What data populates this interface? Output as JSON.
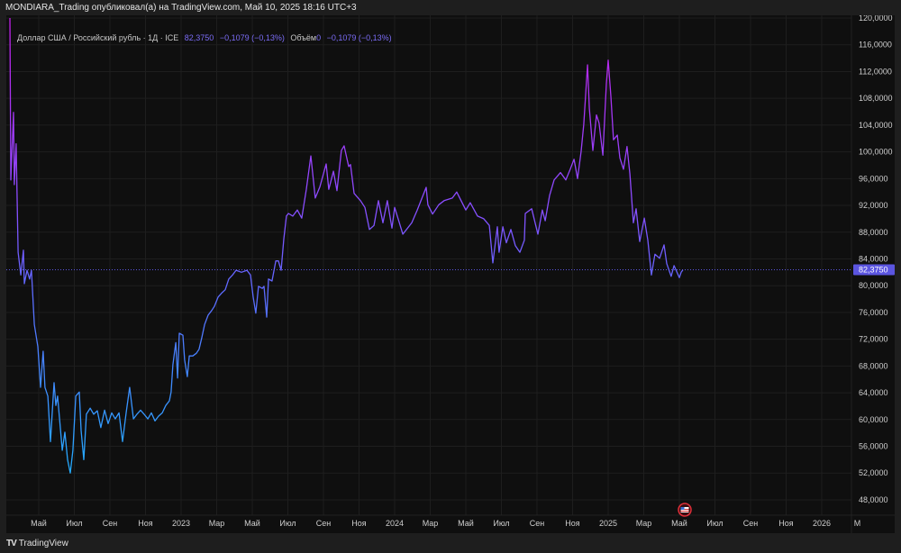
{
  "header": {
    "title": "MONDIARA_Trading опубликовал(а) на TradingView.com, Май 10, 2025 18:16 UTC+3"
  },
  "legend": {
    "symbol": "Доллар США / Российский рубль · 1Д · ICE",
    "price": "82,3750",
    "change": "−0,1079 (−0,13%)",
    "volume_label": "Объём",
    "volume_value": "0",
    "volume_change": "−0,1079 (−0,13%)"
  },
  "footer": {
    "brand": "TradingView"
  },
  "colors": {
    "background": "#0f0f0f",
    "line_top": "#c21fe8",
    "line_mid": "#8a4cff",
    "line_low": "#5b6cff",
    "line_bottom": "#1fb0ff",
    "last_price": "#5b55e0"
  },
  "chart_data": {
    "type": "line",
    "title": "Доллар США / Российский рубль · 1Д · ICE",
    "x_unit": "months since 2022-01",
    "ylim": [
      46,
      121
    ],
    "xlim": [
      1.7,
      50.2
    ],
    "y_ticks": [
      "48,0000",
      "52,0000",
      "56,0000",
      "60,0000",
      "64,0000",
      "68,0000",
      "72,0000",
      "76,0000",
      "80,0000",
      "84,0000",
      "88,0000",
      "92,0000",
      "96,0000",
      "100,0000",
      "104,0000",
      "108,0000",
      "112,0000",
      "116,0000",
      "120,0000"
    ],
    "y_tick_values": [
      48,
      52,
      56,
      60,
      64,
      68,
      72,
      76,
      80,
      84,
      88,
      92,
      96,
      100,
      104,
      108,
      112,
      116,
      120
    ],
    "x_ticks": [
      "Май",
      "Июл",
      "Сен",
      "Ноя",
      "2023",
      "Мар",
      "Май",
      "Июл",
      "Сен",
      "Ноя",
      "2024",
      "Мар",
      "Май",
      "Июл",
      "Сен",
      "Ноя",
      "2025",
      "Мар",
      "Май",
      "Июл",
      "Сен",
      "Ноя",
      "2026",
      "М"
    ],
    "x_tick_values": [
      4,
      6,
      8,
      10,
      12,
      14,
      16,
      18,
      20,
      22,
      24,
      26,
      28,
      30,
      32,
      34,
      36,
      38,
      40,
      42,
      44,
      46,
      48,
      50
    ],
    "last_price": 82.375,
    "last_price_label": "82,3750",
    "grid": true,
    "x": [
      2.38,
      2.43,
      2.58,
      2.63,
      2.73,
      2.84,
      2.99,
      3.14,
      3.19,
      3.34,
      3.49,
      3.59,
      3.75,
      3.95,
      4.1,
      4.25,
      4.35,
      4.51,
      4.66,
      4.86,
      4.96,
      5.06,
      5.17,
      5.32,
      5.47,
      5.62,
      5.77,
      5.92,
      6.08,
      6.28,
      6.38,
      6.53,
      6.68,
      6.89,
      7.09,
      7.29,
      7.49,
      7.7,
      7.9,
      8.1,
      8.3,
      8.51,
      8.71,
      8.91,
      9.11,
      9.32,
      9.52,
      9.72,
      9.92,
      10.13,
      10.33,
      10.53,
      10.73,
      10.94,
      11.14,
      11.34,
      11.44,
      11.54,
      11.7,
      11.8,
      11.9,
      12.1,
      12.2,
      12.35,
      12.46,
      12.66,
      12.86,
      13.01,
      13.16,
      13.32,
      13.52,
      13.72,
      13.87,
      14.08,
      14.28,
      14.48,
      14.68,
      14.89,
      15.09,
      15.39,
      15.7,
      15.9,
      16.05,
      16.2,
      16.35,
      16.56,
      16.66,
      16.81,
      16.91,
      17.11,
      17.32,
      17.47,
      17.62,
      17.77,
      17.92,
      18.03,
      18.28,
      18.53,
      18.78,
      19.04,
      19.29,
      19.54,
      19.8,
      20.15,
      20.3,
      20.56,
      20.76,
      21.01,
      21.16,
      21.42,
      21.52,
      21.72,
      22.08,
      22.33,
      22.58,
      22.84,
      23.09,
      23.34,
      23.59,
      23.85,
      24.0,
      24.46,
      24.96,
      25.27,
      25.77,
      25.87,
      26.13,
      26.48,
      26.78,
      27.24,
      27.49,
      28.0,
      28.25,
      28.66,
      29.01,
      29.32,
      29.52,
      29.77,
      29.87,
      30.08,
      30.28,
      30.53,
      30.78,
      31.04,
      31.29,
      31.34,
      31.7,
      32.05,
      32.3,
      32.46,
      32.71,
      32.96,
      33.32,
      33.62,
      33.87,
      34.08,
      34.28,
      34.48,
      34.63,
      34.84,
      34.94,
      35.14,
      35.34,
      35.49,
      35.7,
      35.9,
      36.0,
      36.15,
      36.3,
      36.51,
      36.66,
      36.86,
      37.06,
      37.22,
      37.42,
      37.57,
      37.77,
      38.03,
      38.23,
      38.43,
      38.63,
      38.89,
      39.14,
      39.29,
      39.54,
      39.7,
      40.0,
      40.1,
      40.2
    ],
    "values": [
      120,
      95.8,
      105.9,
      95.1,
      101.2,
      85.0,
      81.6,
      85.3,
      80.3,
      82.3,
      81.0,
      82.3,
      74.2,
      70.9,
      64.8,
      70.2,
      64.8,
      63.5,
      56.7,
      65.5,
      62.1,
      63.5,
      60.1,
      55.4,
      58.1,
      54.0,
      52.0,
      55.4,
      63.5,
      64.1,
      58.4,
      54.0,
      60.8,
      61.7,
      60.8,
      61.3,
      58.8,
      61.4,
      59.4,
      61.0,
      60.1,
      61.0,
      56.7,
      61.0,
      64.8,
      60.1,
      60.8,
      61.4,
      60.8,
      60.1,
      61.0,
      59.8,
      60.5,
      61.0,
      62.1,
      62.8,
      64.1,
      68.2,
      71.5,
      66.2,
      72.9,
      72.6,
      68.9,
      66.4,
      69.5,
      69.5,
      69.9,
      70.5,
      72.2,
      74.2,
      75.6,
      76.3,
      76.9,
      78.3,
      78.9,
      79.4,
      81.0,
      81.6,
      82.3,
      82.0,
      82.3,
      81.6,
      78.3,
      75.9,
      79.9,
      79.6,
      79.9,
      75.3,
      81.0,
      80.7,
      83.7,
      83.7,
      82.3,
      87.0,
      90.4,
      90.8,
      90.4,
      91.3,
      90.1,
      94.4,
      99.4,
      93.1,
      94.8,
      98.2,
      94.4,
      97.1,
      94.2,
      100.2,
      100.9,
      97.8,
      98.1,
      93.8,
      92.7,
      91.7,
      88.4,
      89.0,
      92.7,
      89.4,
      92.7,
      88.6,
      91.7,
      87.7,
      89.4,
      91.3,
      94.7,
      92.1,
      90.7,
      92.1,
      92.7,
      93.1,
      94.0,
      91.3,
      92.4,
      90.4,
      90.0,
      89.0,
      83.4,
      88.8,
      85.0,
      88.8,
      86.4,
      88.4,
      86.0,
      85.0,
      86.8,
      90.8,
      91.5,
      87.7,
      91.3,
      89.7,
      93.5,
      95.8,
      96.9,
      95.8,
      97.4,
      98.9,
      96.0,
      100.1,
      104.1,
      113.0,
      106.5,
      100.2,
      105.5,
      104.3,
      99.5,
      110.2,
      113.7,
      108.3,
      101.8,
      102.5,
      99.1,
      97.4,
      100.8,
      96.7,
      89.4,
      91.5,
      86.6,
      90.1,
      86.8,
      81.6,
      84.7,
      84.1,
      86.1,
      83.3,
      81.4,
      83.0,
      81.2,
      82.0,
      82.375
    ]
  }
}
